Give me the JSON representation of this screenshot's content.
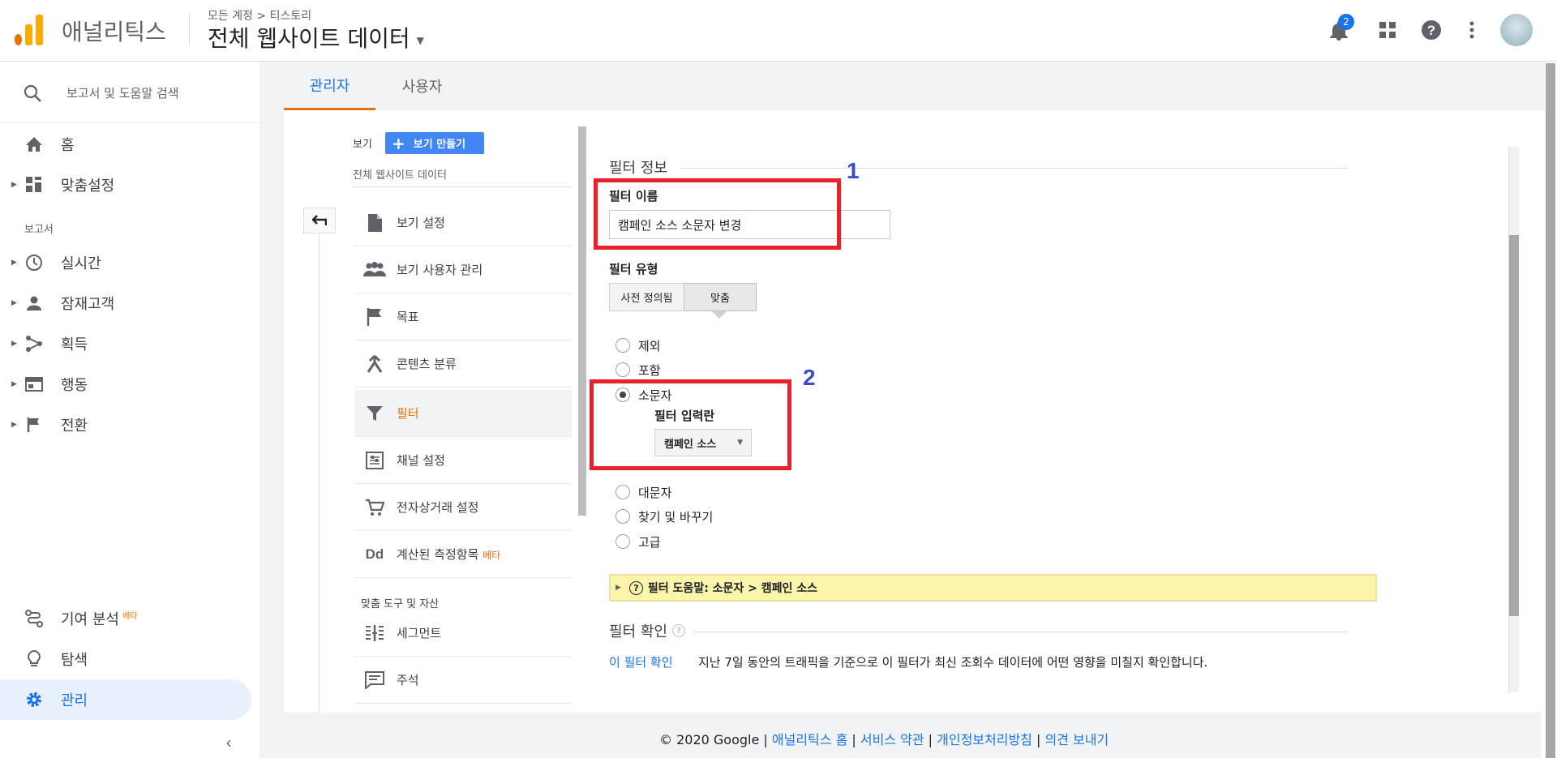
{
  "header": {
    "app_name": "애널리틱스",
    "breadcrumb": "모든 계정 > 티스토리",
    "property_title": "전체 웹사이트 데이터",
    "notification_count": "2"
  },
  "sidebar": {
    "search_placeholder": "보고서 및 도움말 검색",
    "home": "홈",
    "customization": "맞춤설정",
    "reports_header": "보고서",
    "realtime": "실시간",
    "audience": "잠재고객",
    "acquisition": "획득",
    "behavior": "행동",
    "conversions": "전환",
    "attribution": "기여 분석",
    "attribution_badge": "베타",
    "discover": "탐색",
    "admin": "관리"
  },
  "tabs": {
    "admin": "관리자",
    "user": "사용자"
  },
  "view_column": {
    "view_label": "보기",
    "create_view_button": "보기 만들기",
    "view_name": "전체 웹사이트 데이터",
    "items": [
      {
        "label": "보기 설정",
        "icon": "document-icon"
      },
      {
        "label": "보기 사용자 관리",
        "icon": "people-icon"
      },
      {
        "label": "목표",
        "icon": "flag-icon"
      },
      {
        "label": "콘텐츠 분류",
        "icon": "merge-icon"
      },
      {
        "label": "필터",
        "icon": "filter-icon"
      },
      {
        "label": "채널 설정",
        "icon": "channel-icon"
      },
      {
        "label": "전자상거래 설정",
        "icon": "cart-icon"
      },
      {
        "label": "계산된 측정항목",
        "icon": "dd-icon",
        "badge": "베타"
      }
    ],
    "tools_header": "맞춤 도구 및 자산",
    "tools": [
      {
        "label": "세그먼트",
        "icon": "segment-icon"
      },
      {
        "label": "주석",
        "icon": "comment-icon"
      }
    ]
  },
  "filter_form": {
    "section_title": "필터 정보",
    "name_label": "필터 이름",
    "name_value": "캠페인 소스 소문자 변경",
    "type_label": "필터 유형",
    "type_predefined": "사전 정의됨",
    "type_custom": "맞춤",
    "options": [
      "제외",
      "포함",
      "소문자",
      "대문자",
      "찾기 및 바꾸기",
      "고급"
    ],
    "selected_option": "소문자",
    "input_field_label": "필터 입력란",
    "input_field_value": "캠페인 소스",
    "help_bar": "필터 도움말: 소문자 > 캠페인 소스",
    "verify_title": "필터 확인",
    "verify_link": "이 필터 확인",
    "verify_desc": "지난 7일 동안의 트래픽을 기준으로 이 필터가 최신 조회수 데이터에 어떤 영향을 미칠지 확인합니다."
  },
  "annotations": {
    "first": "1",
    "second": "2"
  },
  "footer": {
    "copyright": "© 2020 Google |",
    "links": [
      "애널리틱스 홈",
      "서비스 약관",
      "개인정보처리방침",
      "의견 보내기"
    ],
    "sep": "|"
  },
  "colors": {
    "accent": "#1a73e8",
    "brand_orange": "#f9ab00",
    "active_red": "#e8710a",
    "annotation_red": "#e8202a",
    "annotation_blue": "#3b4cca"
  }
}
